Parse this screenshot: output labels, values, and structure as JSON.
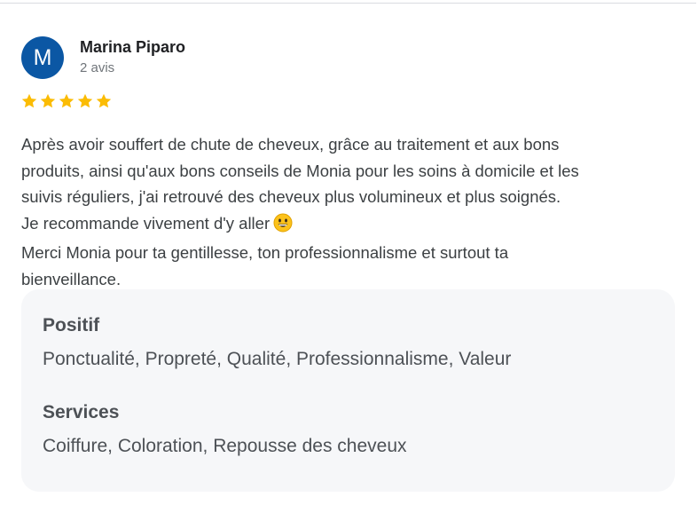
{
  "reviewer": {
    "initial": "M",
    "name": "Marina Piparo",
    "meta": "2 avis",
    "avatar_color": "#0b57a4"
  },
  "rating": {
    "stars": 5,
    "max": 5,
    "star_color": "#fbbc04"
  },
  "review": {
    "text": "Après avoir souffert de chute de cheveux, grâce au traitement et aux bons\nproduits, ainsi qu'aux bons conseils de Monia pour les soins à domicile et les\nsuivis réguliers, j'ai retrouvé des cheveux plus volumineux et plus soignés.\nJe recommande vivement d'y aller",
    "emoji": "grinning-face-icon",
    "text_after": "Merci Monia pour ta gentillesse, ton professionnalisme et surtout ta\nbienveillance."
  },
  "attributes": [
    {
      "title": "Positif",
      "value": "Ponctualité, Propreté, Qualité, Professionnalisme, Valeur"
    },
    {
      "title": "Services",
      "value": "Coiffure, Coloration, Repousse des cheveux"
    }
  ]
}
